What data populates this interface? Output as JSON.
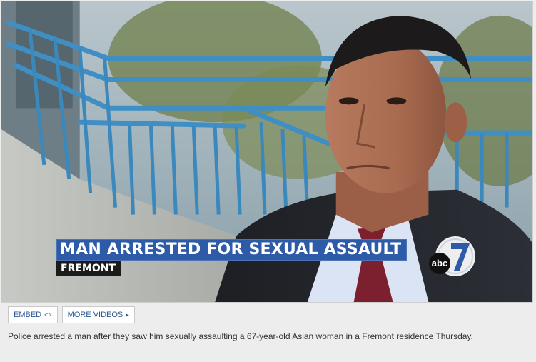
{
  "video": {
    "lower_third_title": "MAN ARRESTED FOR SEXUAL ASSAULT",
    "lower_third_location": "FREMONT",
    "logo_text": "abc",
    "logo_number": "7",
    "brand_color": "#2d5ba8"
  },
  "controls": {
    "embed_label": "EMBED",
    "embed_icon": "<>",
    "more_videos_label": "MORE VIDEOS",
    "more_videos_icon": "▸"
  },
  "caption": {
    "text": "Police arrested a man after they saw him sexually assaulting a 67-year-old Asian woman in a Fremont residence Thursday."
  }
}
